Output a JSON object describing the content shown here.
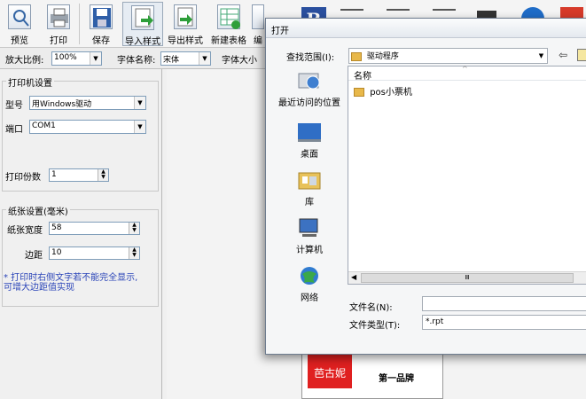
{
  "toolbar": {
    "buttons": [
      {
        "label": "预览",
        "icon": "preview-icon"
      },
      {
        "label": "打印",
        "icon": "printer-icon"
      },
      {
        "label": "保存",
        "icon": "save-icon"
      },
      {
        "label": "导入样式",
        "icon": "import-style-icon"
      },
      {
        "label": "导出样式",
        "icon": "export-style-icon"
      },
      {
        "label": "新建表格",
        "icon": "new-table-icon"
      },
      {
        "label": "编",
        "icon": "edit-icon"
      }
    ]
  },
  "optbar": {
    "zoom_label": "放大比例:",
    "zoom_value": "100%",
    "font_name_label": "字体名称:",
    "font_name_value": "宋体",
    "font_size_label": "字体大小"
  },
  "printer": {
    "title": "打印机设置",
    "model_label": "型号",
    "model_value": "用Windows驱动",
    "port_label": "端口",
    "port_value": "COM1",
    "copies_label": "打印份数",
    "copies_value": "1"
  },
  "paper": {
    "title": "纸张设置(毫米)",
    "width_label": "纸张宽度",
    "width_value": "58",
    "margin_label": "边距",
    "margin_value": "10",
    "note_line1": "* 打印时右侧文字若不能完全显示,",
    "note_line2": "可增大边距值实现"
  },
  "preview": {
    "logo_text": "芭古妮",
    "line1": "第一品牌"
  },
  "dialog": {
    "title": "打开",
    "lookin_label": "查找范围(I):",
    "lookin_value": "驱动程序",
    "places": [
      {
        "label": "最近访问的位置",
        "icon": "recent-places-icon"
      },
      {
        "label": "桌面",
        "icon": "desktop-icon"
      },
      {
        "label": "库",
        "icon": "library-icon"
      },
      {
        "label": "计算机",
        "icon": "computer-icon"
      },
      {
        "label": "网络",
        "icon": "network-icon"
      }
    ],
    "column_name": "名称",
    "files": [
      {
        "name": "pos小票机"
      }
    ],
    "filename_label": "文件名(N):",
    "filename_value": "",
    "filetype_label": "文件类型(T):",
    "filetype_value": "*.rpt",
    "scroll_mark": "Ⅲ"
  }
}
